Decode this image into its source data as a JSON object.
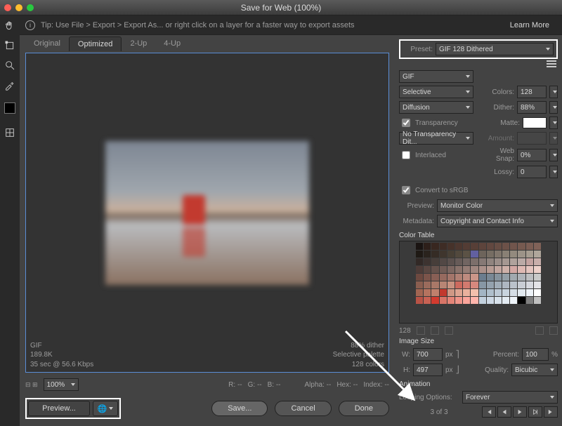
{
  "window": {
    "title": "Save for Web (100%)"
  },
  "tipbar": {
    "text": "Tip: Use File > Export > Export As...  or right click on a layer for a faster way to export assets",
    "learn_more": "Learn More"
  },
  "tabs": {
    "original": "Original",
    "optimized": "Optimized",
    "two_up": "2-Up",
    "four_up": "4-Up"
  },
  "preview_info": {
    "format": "GIF",
    "size": "189.8K",
    "speed": "35 sec @ 56.6 Kbps",
    "dither": "88% dither",
    "palette": "Selective palette",
    "colors": "128 colors"
  },
  "status": {
    "zoom": "100%",
    "r": "R:  --",
    "g": "G:  --",
    "b": "B:  --",
    "alpha": "Alpha:  --",
    "hex": "Hex:  --",
    "index": "Index:  --"
  },
  "preview_button": "Preview...",
  "footer": {
    "save": "Save...",
    "cancel": "Cancel",
    "done": "Done"
  },
  "preset": {
    "label": "Preset:",
    "value": "GIF 128 Dithered",
    "format": "GIF",
    "reduction": "Selective",
    "colors_label": "Colors:",
    "colors": "128",
    "dither_method": "Diffusion",
    "dither_label": "Dither:",
    "dither": "88%",
    "transparency_label": "Transparency",
    "transparency_checked": true,
    "matte_label": "Matte:",
    "notrans": "No Transparency Dit...",
    "amount_label": "Amount:",
    "interlaced_label": "Interlaced",
    "interlaced_checked": false,
    "websnap_label": "Web Snap:",
    "websnap": "0%",
    "lossy_label": "Lossy:",
    "lossy": "0",
    "srgb_label": "Convert to sRGB",
    "srgb_checked": true,
    "preview_label": "Preview:",
    "preview_value": "Monitor Color",
    "metadata_label": "Metadata:",
    "metadata_value": "Copyright and Contact Info"
  },
  "colortable": {
    "label": "Color Table",
    "count": "128",
    "colors": [
      "#1a1412",
      "#2d1f1a",
      "#382720",
      "#3e2c25",
      "#46322a",
      "#4d372f",
      "#533c34",
      "#573f37",
      "#5d443c",
      "#624840",
      "#674d44",
      "#6c5148",
      "#71554c",
      "#765a50",
      "#7b5e54",
      "#806258",
      "#1f1a15",
      "#2a231d",
      "#352c25",
      "#3f352d",
      "#484035",
      "#52493d",
      "#5b5245",
      "#6260a0",
      "#6d645b",
      "#766d63",
      "#80766c",
      "#898075",
      "#938a7e",
      "#9c9388",
      "#a69d91",
      "#afa69b",
      "#322926",
      "#3d3330",
      "#473e3a",
      "#524845",
      "#5c514e",
      "#675b58",
      "#716562",
      "#7c6f6b",
      "#867975",
      "#90847f",
      "#9b8e89",
      "#a59892",
      "#b0a29c",
      "#baaaa6",
      "#c3a3a0",
      "#c9afab",
      "#4e3c38",
      "#5a4742",
      "#66524c",
      "#715c56",
      "#7d6761",
      "#89726b",
      "#947c75",
      "#a08780",
      "#ab918a",
      "#b79c94",
      "#c2a69f",
      "#ceb1a9",
      "#d4a8a4",
      "#deb9b3",
      "#e4c5bf",
      "#edd1ca",
      "#6d4940",
      "#7b544a",
      "#885f55",
      "#966a5f",
      "#a3756a",
      "#b08074",
      "#be8b7f",
      "#cb9689",
      "#6b7d8e",
      "#798895",
      "#86939d",
      "#939ea6",
      "#a1a9af",
      "#aeb3b8",
      "#bcbec0",
      "#c9cac9",
      "#8a5e50",
      "#9a6b5c",
      "#a97868",
      "#b88574",
      "#c89280",
      "#cc6a5e",
      "#d37a6f",
      "#d6887e",
      "#8797a5",
      "#94a2ae",
      "#a1adb8",
      "#aeb7c1",
      "#bbc2cb",
      "#c9cdd4",
      "#d6d8de",
      "#e3e3e7",
      "#a26552",
      "#b5735f",
      "#c0806c",
      "#c2392d",
      "#cf9885",
      "#dda491",
      "#eab19d",
      "#f2c0ad",
      "#a3b5c4",
      "#afbfcc",
      "#bcc9d5",
      "#c8d4de",
      "#d5dee6",
      "#e1e9ef",
      "#eef3f8",
      "#ffffff",
      "#b85346",
      "#c86254",
      "#d33b2f",
      "#d87567",
      "#e48578",
      "#ef958a",
      "#fba59b",
      "#ffb5ac",
      "#c3d1de",
      "#ced9e5",
      "#d8e2eb",
      "#e3ebf2",
      "#eef4f9",
      "#000000",
      "#808080",
      "#c0c0c0"
    ]
  },
  "imagesize": {
    "label": "Image Size",
    "w_label": "W:",
    "w": "700",
    "h_label": "H:",
    "h": "497",
    "px": "px",
    "percent_label": "Percent:",
    "percent": "100",
    "pct_sym": "%",
    "quality_label": "Quality:",
    "quality": "Bicubic"
  },
  "animation": {
    "label": "Animation",
    "loop_label": "Looping Options:",
    "loop": "Forever",
    "frame": "3 of 3"
  }
}
